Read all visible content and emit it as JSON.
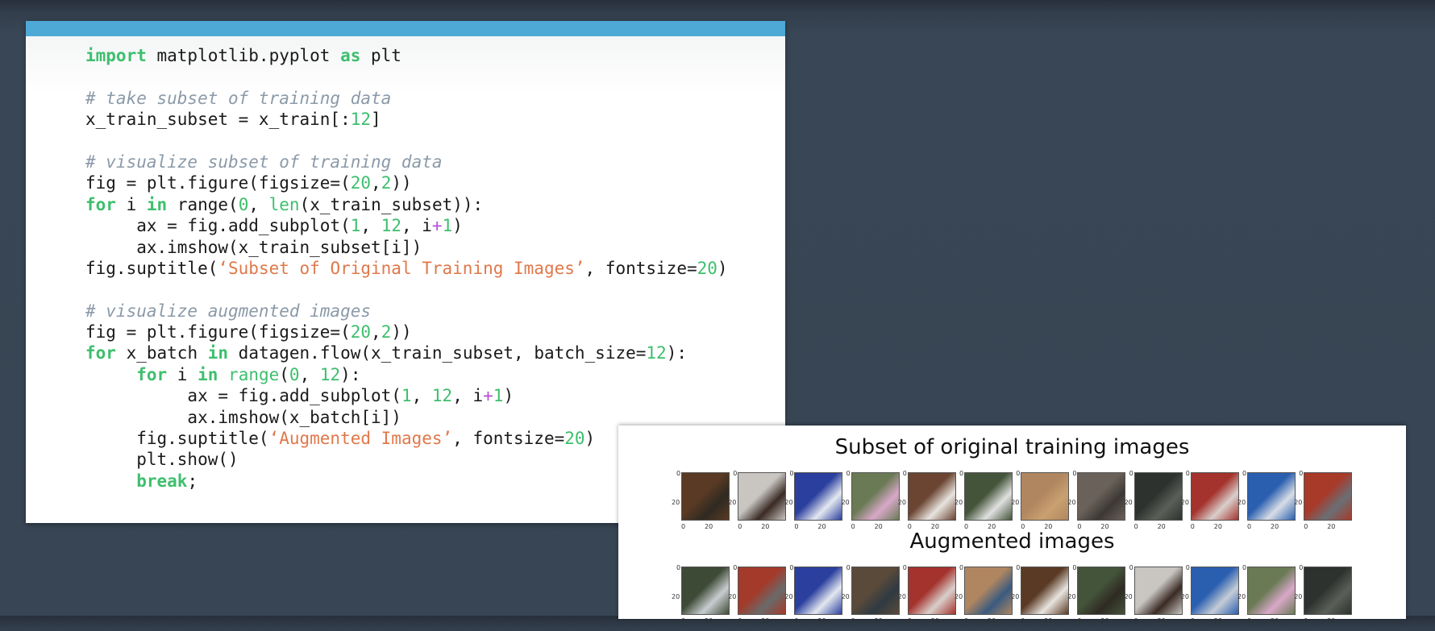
{
  "code": {
    "lines": [
      [
        {
          "t": "import",
          "c": "kw"
        },
        {
          "t": " matplotlib.pyplot ",
          "c": ""
        },
        {
          "t": "as",
          "c": "kw"
        },
        {
          "t": " plt",
          "c": ""
        }
      ],
      [],
      [
        {
          "t": "# take subset of training data",
          "c": "cm"
        }
      ],
      [
        {
          "t": "x_train_subset = x_train[:",
          "c": ""
        },
        {
          "t": "12",
          "c": "num"
        },
        {
          "t": "]",
          "c": ""
        }
      ],
      [],
      [
        {
          "t": "# visualize subset of training data",
          "c": "cm"
        }
      ],
      [
        {
          "t": "fig = plt.figure(figsize=(",
          "c": ""
        },
        {
          "t": "20",
          "c": "num"
        },
        {
          "t": ",",
          "c": ""
        },
        {
          "t": "2",
          "c": "num"
        },
        {
          "t": "))",
          "c": ""
        }
      ],
      [
        {
          "t": "for",
          "c": "kw"
        },
        {
          "t": " i ",
          "c": ""
        },
        {
          "t": "in",
          "c": "kw"
        },
        {
          "t": " range(",
          "c": ""
        },
        {
          "t": "0",
          "c": "num"
        },
        {
          "t": ", ",
          "c": ""
        },
        {
          "t": "len",
          "c": "fn"
        },
        {
          "t": "(x_train_subset)):",
          "c": ""
        }
      ],
      [
        {
          "t": "     ax = fig.add_subplot(",
          "c": ""
        },
        {
          "t": "1",
          "c": "num"
        },
        {
          "t": ", ",
          "c": ""
        },
        {
          "t": "12",
          "c": "num"
        },
        {
          "t": ", i",
          "c": ""
        },
        {
          "t": "+",
          "c": "op"
        },
        {
          "t": "1",
          "c": "num"
        },
        {
          "t": ")",
          "c": ""
        }
      ],
      [
        {
          "t": "     ax.imshow(x_train_subset[i])",
          "c": ""
        }
      ],
      [
        {
          "t": "fig.suptitle(",
          "c": ""
        },
        {
          "t": "‘Subset of Original Training Images’",
          "c": "str"
        },
        {
          "t": ", fontsize=",
          "c": ""
        },
        {
          "t": "20",
          "c": "num"
        },
        {
          "t": ")",
          "c": ""
        }
      ],
      [],
      [
        {
          "t": "# visualize augmented images",
          "c": "cm"
        }
      ],
      [
        {
          "t": "fig = plt.figure(figsize=(",
          "c": ""
        },
        {
          "t": "20",
          "c": "num"
        },
        {
          "t": ",",
          "c": ""
        },
        {
          "t": "2",
          "c": "num"
        },
        {
          "t": "))",
          "c": ""
        }
      ],
      [
        {
          "t": "for",
          "c": "kw"
        },
        {
          "t": " x_batch ",
          "c": ""
        },
        {
          "t": "in",
          "c": "kw"
        },
        {
          "t": " datagen.flow(x_train_subset, batch_size=",
          "c": ""
        },
        {
          "t": "12",
          "c": "num"
        },
        {
          "t": "):",
          "c": ""
        }
      ],
      [
        {
          "t": "     ",
          "c": ""
        },
        {
          "t": "for",
          "c": "kw"
        },
        {
          "t": " i ",
          "c": ""
        },
        {
          "t": "in",
          "c": "kw"
        },
        {
          "t": " ",
          "c": ""
        },
        {
          "t": "range",
          "c": "fn"
        },
        {
          "t": "(",
          "c": ""
        },
        {
          "t": "0",
          "c": "num"
        },
        {
          "t": ", ",
          "c": ""
        },
        {
          "t": "12",
          "c": "num"
        },
        {
          "t": "):",
          "c": ""
        }
      ],
      [
        {
          "t": "          ax = fig.add_subplot(",
          "c": ""
        },
        {
          "t": "1",
          "c": "num"
        },
        {
          "t": ", ",
          "c": ""
        },
        {
          "t": "12",
          "c": "num"
        },
        {
          "t": ", i",
          "c": ""
        },
        {
          "t": "+",
          "c": "op"
        },
        {
          "t": "1",
          "c": "num"
        },
        {
          "t": ")",
          "c": ""
        }
      ],
      [
        {
          "t": "          ax.imshow(x_batch[i])",
          "c": ""
        }
      ],
      [
        {
          "t": "     fig.suptitle(",
          "c": ""
        },
        {
          "t": "‘Augmented Images’",
          "c": "str"
        },
        {
          "t": ", fontsize=",
          "c": ""
        },
        {
          "t": "20",
          "c": "num"
        },
        {
          "t": ")",
          "c": ""
        }
      ],
      [
        {
          "t": "     plt.show()",
          "c": ""
        }
      ],
      [
        {
          "t": "     ",
          "c": ""
        },
        {
          "t": "break",
          "c": "kw"
        },
        {
          "t": ";",
          "c": ""
        }
      ]
    ]
  },
  "output": {
    "original_title": "Subset of original training images",
    "augmented_title": "Augmented images",
    "tick_0": "0",
    "tick_20": "20",
    "original_colors": [
      [
        "#5a3a24",
        "#2f2a22"
      ],
      [
        "#c9c6c2",
        "#3a2a24"
      ],
      [
        "#2a3f9e",
        "#e4e8f0"
      ],
      [
        "#6a7a55",
        "#d8a8c8"
      ],
      [
        "#6b4432",
        "#e8e4df"
      ],
      [
        "#44543a",
        "#e0e0e0"
      ],
      [
        "#b08660",
        "#c9a070"
      ],
      [
        "#6a625a",
        "#3d3834"
      ],
      [
        "#2e322f",
        "#5a5f58"
      ],
      [
        "#a4322d",
        "#d9cfcb"
      ],
      [
        "#2a5fb0",
        "#d8dde6"
      ],
      [
        "#a83a2a",
        "#6a6f75"
      ]
    ],
    "augmented_colors": [
      [
        "#3d4a35",
        "#c8ccd0"
      ],
      [
        "#a33a2a",
        "#6a6a6a"
      ],
      [
        "#2a3f9e",
        "#e4e8f0"
      ],
      [
        "#5a4a3a",
        "#2f3a42"
      ],
      [
        "#a4322d",
        "#d9cfcb"
      ],
      [
        "#b08660",
        "#3a5a80"
      ],
      [
        "#5a3a24",
        "#e8e4df"
      ],
      [
        "#44543a",
        "#2f2a22"
      ],
      [
        "#c9c6c2",
        "#3a2a24"
      ],
      [
        "#2a5fb0",
        "#c4ccd6"
      ],
      [
        "#6a7a55",
        "#d8a8c8"
      ],
      [
        "#2e322f",
        "#5a5f58"
      ]
    ]
  }
}
